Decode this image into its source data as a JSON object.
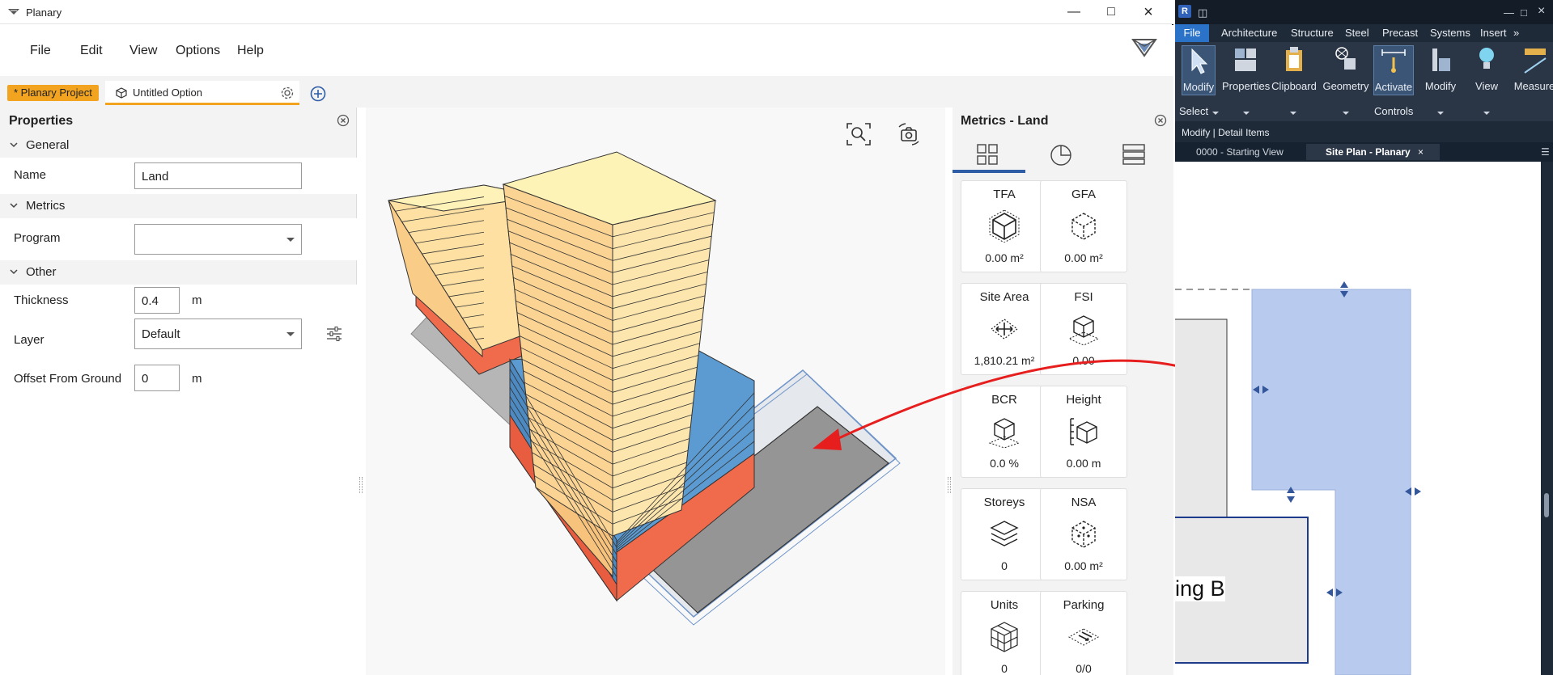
{
  "planary": {
    "title": "Planary",
    "menu": [
      "File",
      "Edit",
      "View",
      "Options",
      "Help"
    ],
    "tabs": {
      "project": "* Planary Project",
      "option": "Untitled Option"
    },
    "properties": {
      "title": "Properties",
      "sections": {
        "general": "General",
        "metrics": "Metrics",
        "other": "Other"
      },
      "fields": {
        "name_label": "Name",
        "name_value": "Land",
        "program_label": "Program",
        "program_value": "",
        "thickness_label": "Thickness",
        "thickness_value": "0.4",
        "thickness_unit": "m",
        "layer_label": "Layer",
        "layer_value": "Default",
        "offset_label": "Offset From Ground",
        "offset_value": "0",
        "offset_unit": "m"
      }
    },
    "metrics": {
      "title": "Metrics - Land",
      "cards": [
        {
          "title": "TFA",
          "value": "0.00 m²",
          "icon": "cube-solid-icon"
        },
        {
          "title": "GFA",
          "value": "0.00 m²",
          "icon": "cube-dashed-icon"
        },
        {
          "title": "Site Area",
          "value": "1,810.21 m²",
          "icon": "site-area-icon"
        },
        {
          "title": "FSI",
          "value": "0.00",
          "icon": "fsi-icon"
        },
        {
          "title": "BCR",
          "value": "0.0 %",
          "icon": "bcr-icon"
        },
        {
          "title": "Height",
          "value": "0.00 m",
          "icon": "height-icon"
        },
        {
          "title": "Storeys",
          "value": "0",
          "icon": "layers-icon"
        },
        {
          "title": "NSA",
          "value": "0.00 m²",
          "icon": "nsa-icon"
        },
        {
          "title": "Units",
          "value": "0",
          "icon": "units-icon"
        },
        {
          "title": "Parking",
          "value": "0/0",
          "icon": "parking-icon"
        }
      ]
    },
    "colors": {
      "accent": "#f2a420",
      "floor_yellow": "#fde4a8",
      "podium_blue": "#5b9bd1",
      "base_red": "#f06a4c"
    }
  },
  "revit": {
    "logo": "R",
    "menu": {
      "file": "File",
      "items": [
        "Architecture",
        "Structure",
        "Steel",
        "Precast",
        "Systems",
        "Insert"
      ]
    },
    "ribbon": {
      "buttons": [
        "Modify",
        "Properties",
        "Clipboard",
        "Geometry",
        "Activate",
        "Modify",
        "View",
        "Measure"
      ],
      "groups": {
        "select": "Select",
        "controls": "Controls"
      }
    },
    "context": "Modify | Detail Items",
    "view_tabs": [
      "0000 - Starting View",
      "Site Plan - Planary"
    ],
    "canvas_label": "ing B"
  }
}
